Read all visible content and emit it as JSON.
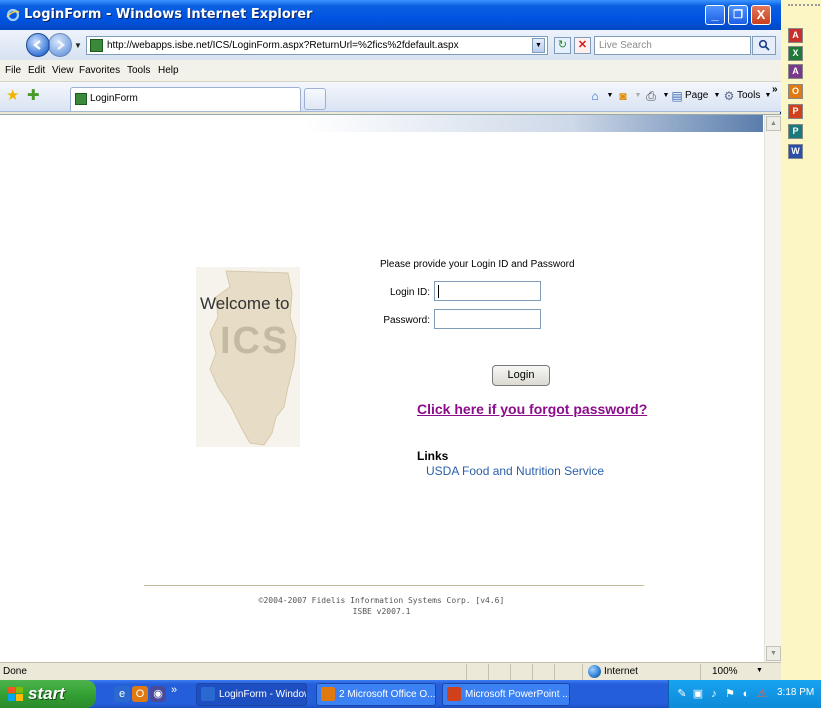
{
  "window": {
    "title": "LoginForm - Windows Internet Explorer",
    "minimize": "_",
    "maximize": "❐",
    "close": "X"
  },
  "navigation": {
    "url": "http://webapps.isbe.net/ICS/LoginForm.aspx?ReturnUrl=%2fics%2fdefault.aspx",
    "search_placeholder": "Live Search"
  },
  "menu": [
    "File",
    "Edit",
    "View",
    "Favorites",
    "Tools",
    "Help"
  ],
  "tabs": {
    "active_label": "LoginForm"
  },
  "command_bar": {
    "page_label": "Page",
    "tools_label": "Tools",
    "overflow": "»"
  },
  "page": {
    "welcome_text": "Welcome to",
    "logo_text": "ICS",
    "prompt": "Please provide your Login ID and Password",
    "login_id_label": "Login ID:",
    "login_id_value": "",
    "password_label": "Password:",
    "password_value": "",
    "login_button": "Login",
    "forgot_link": "Click here if you forgot password?",
    "links_heading": "Links",
    "links": [
      "USDA Food and Nutrition Service"
    ],
    "footer_copyright": "©2004-2007 Fidelis Information Systems Corp. [v4.6]",
    "footer_version": "ISBE v2007.1"
  },
  "statusbar": {
    "status": "Done",
    "zone": "Internet",
    "zoom": "100%"
  },
  "taskbar": {
    "start_label": "start",
    "overflow": "»",
    "tasks": [
      {
        "label": "LoginForm - Windows..."
      },
      {
        "label": "2 Microsoft Office O..."
      },
      {
        "label": "Microsoft PowerPoint ..."
      }
    ],
    "clock": "3:18 PM"
  },
  "colors": {
    "titlebar": "#0054e3",
    "page_background": "#ffffff",
    "forgot_link": "#8c0c8c",
    "external_link": "#2a5fa8",
    "start_button": "#33a133",
    "desktop_bar": "#fbf6c4"
  },
  "icons": {
    "office_bar": [
      "acrobat-icon",
      "excel-icon",
      "access-icon",
      "outlook-icon",
      "powerpoint-icon",
      "publisher-icon",
      "word-icon"
    ]
  }
}
